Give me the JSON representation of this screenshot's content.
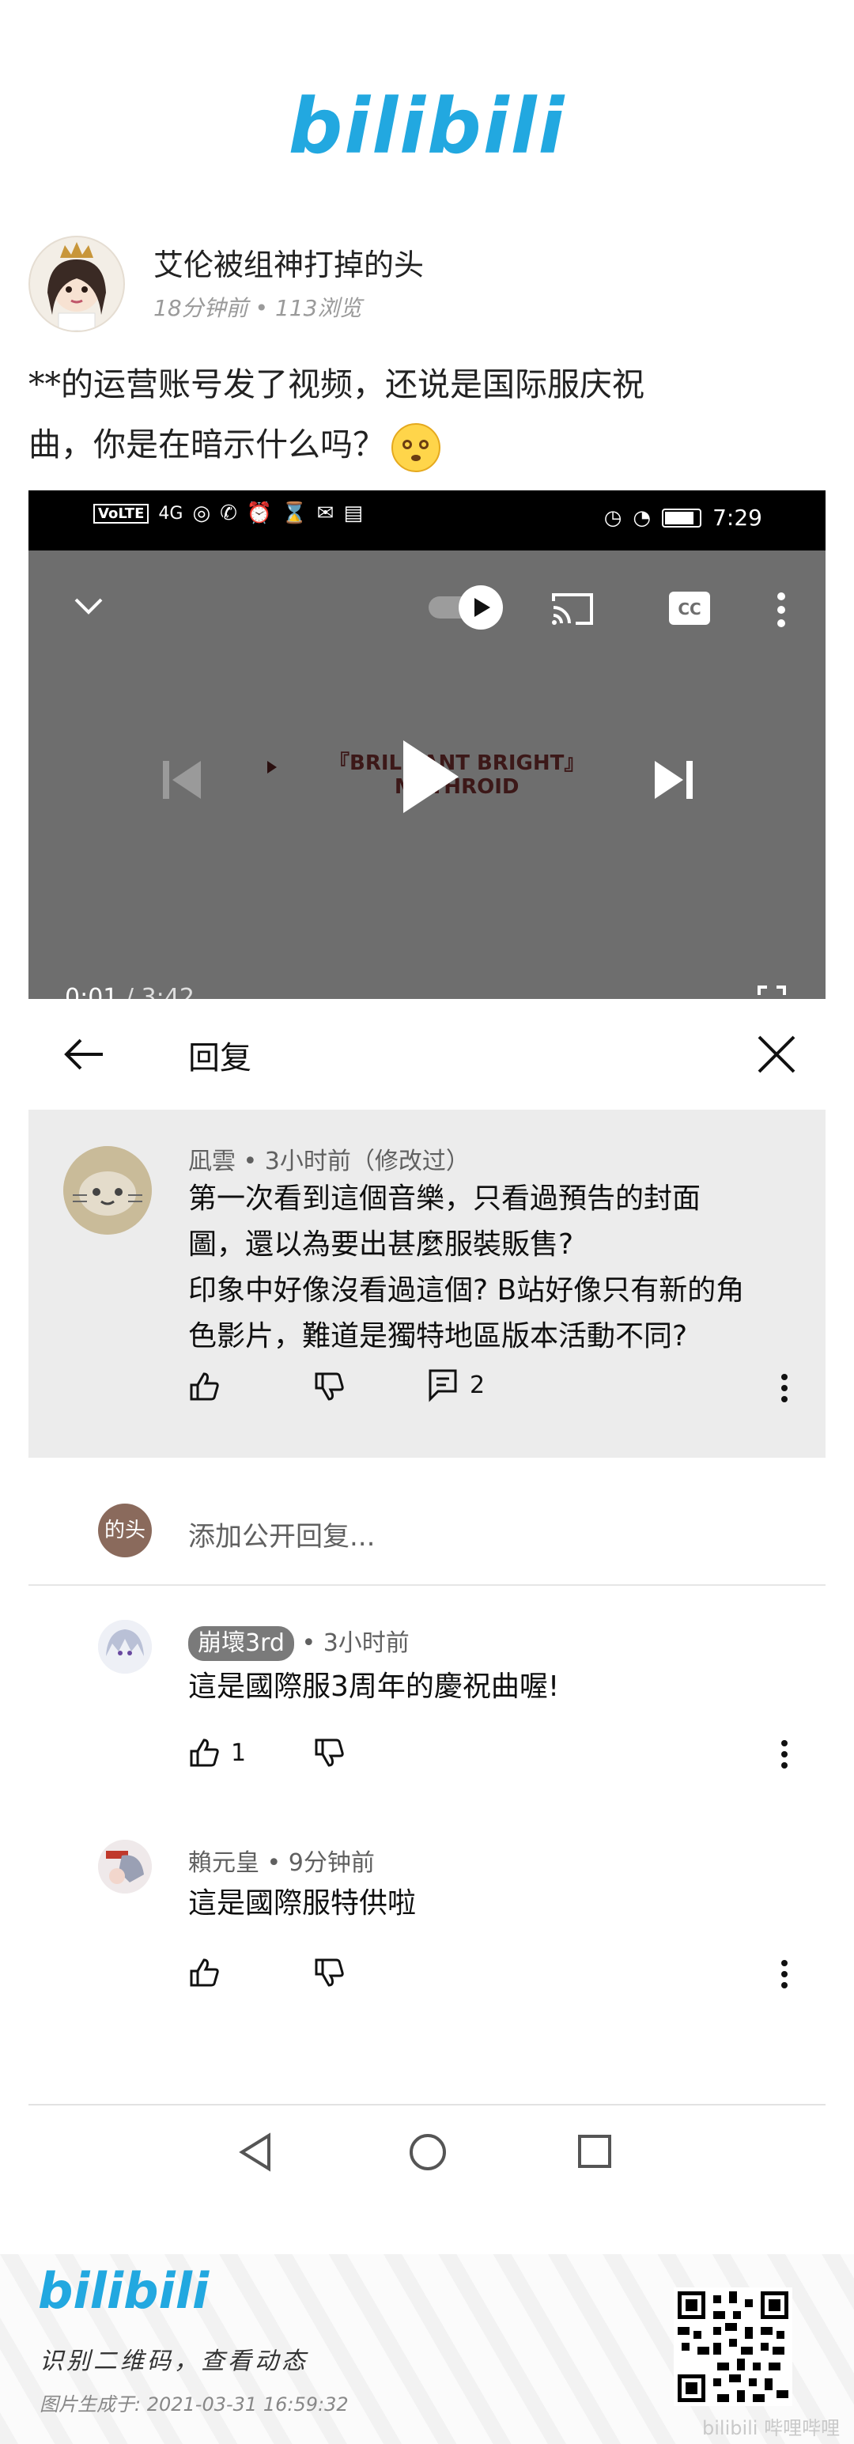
{
  "brand": {
    "logo_text": "bilibili",
    "color": "#22a8e0"
  },
  "post": {
    "author_name": "艾伦被组神打掉的头",
    "meta": "18分钟前 • 113浏览",
    "text_line1": "**的运营账号发了视频，还说是国际服庆祝",
    "text_line2": "曲，你是在暗示什么吗？",
    "emoji": "flushed-face"
  },
  "phone_status": {
    "network_chip": "VoLTE",
    "signal": "4G",
    "time": "7:29"
  },
  "player": {
    "video_title_line1": "『BRILLIANT BRIGHT』",
    "video_title_line2": "MYTHROID",
    "current_time": "0:01",
    "separator": " / ",
    "duration": "3:42",
    "progress_fraction": 0.003,
    "progress_color": "#ff0000"
  },
  "reply_panel": {
    "title": "回复",
    "parent": {
      "author": "凪雲",
      "meta": " • 3小时前（修改过）",
      "lines": [
        "第一次看到這個音樂，只看過預告的封面",
        "圖，還以為要出甚麼服裝販售?",
        "印象中好像沒看過這個? B站好像只有新的角",
        "色影片，難道是獨特地區版本活動不同?"
      ],
      "reply_count": "2"
    },
    "add_reply": {
      "avatar_text": "的头",
      "placeholder": "添加公开回复..."
    },
    "replies": [
      {
        "author_badge": "崩壞3rd",
        "meta": " • 3小时前",
        "text": "這是國際服3周年的慶祝曲喔!",
        "likes": "1"
      },
      {
        "author": "賴元皇",
        "meta": " • 9分钟前",
        "text": "這是國際服特供啦",
        "likes": ""
      }
    ]
  },
  "footer": {
    "logo_text": "bilibili",
    "slogan": "识别二维码，查看动态",
    "generated": "图片生成于: 2021-03-31 16:59:32",
    "watermark": "bilibili 哔哩哔哩"
  }
}
